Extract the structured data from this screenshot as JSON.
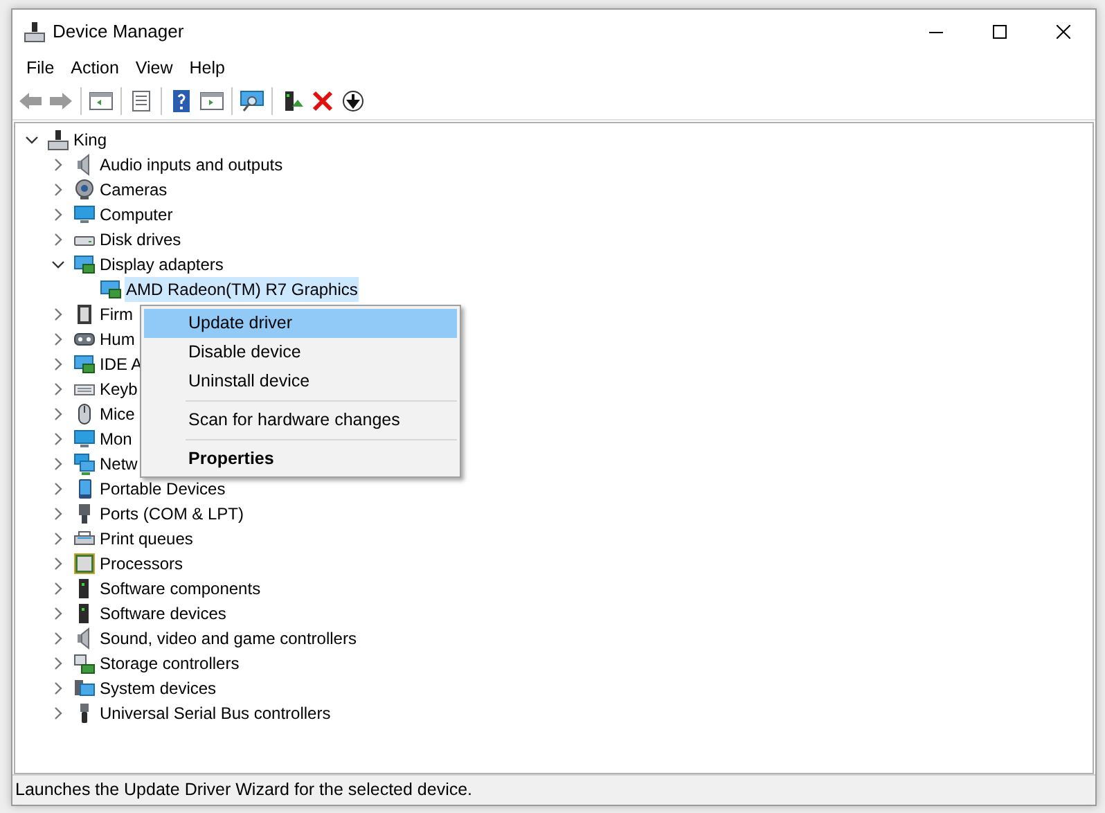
{
  "window": {
    "title": "Device Manager"
  },
  "menu_bar": [
    "File",
    "Action",
    "View",
    "Help"
  ],
  "tree": {
    "label": "King",
    "expanded": true,
    "selected": false,
    "children": [
      {
        "label": "Audio inputs and outputs",
        "expanded": false,
        "selected": false
      },
      {
        "label": "Cameras",
        "expanded": false,
        "selected": false
      },
      {
        "label": "Computer",
        "expanded": false,
        "selected": false
      },
      {
        "label": "Disk drives",
        "expanded": false,
        "selected": false
      },
      {
        "label": "Display adapters",
        "expanded": true,
        "selected": false,
        "children": [
          {
            "label": "AMD Radeon(TM) R7 Graphics",
            "selected": true
          }
        ]
      },
      {
        "label": "Firm",
        "expanded": false,
        "selected": false
      },
      {
        "label": "Hum",
        "expanded": false,
        "selected": false
      },
      {
        "label": "IDE A",
        "expanded": false,
        "selected": false
      },
      {
        "label": "Keyb",
        "expanded": false,
        "selected": false
      },
      {
        "label": "Mice",
        "expanded": false,
        "selected": false
      },
      {
        "label": "Mon",
        "expanded": false,
        "selected": false
      },
      {
        "label": "Netw",
        "expanded": false,
        "selected": false
      },
      {
        "label": "Portable Devices",
        "expanded": false,
        "selected": false
      },
      {
        "label": "Ports (COM & LPT)",
        "expanded": false,
        "selected": false
      },
      {
        "label": "Print queues",
        "expanded": false,
        "selected": false
      },
      {
        "label": "Processors",
        "expanded": false,
        "selected": false
      },
      {
        "label": "Software components",
        "expanded": false,
        "selected": false
      },
      {
        "label": "Software devices",
        "expanded": false,
        "selected": false
      },
      {
        "label": "Sound, video and game controllers",
        "expanded": false,
        "selected": false
      },
      {
        "label": "Storage controllers",
        "expanded": false,
        "selected": false
      },
      {
        "label": "System devices",
        "expanded": false,
        "selected": false
      },
      {
        "label": "Universal Serial Bus controllers",
        "expanded": false,
        "selected": false
      }
    ]
  },
  "context_menu": [
    {
      "label": "Update driver",
      "selected": true,
      "default": false,
      "separator_after": false
    },
    {
      "label": "Disable device",
      "selected": false,
      "default": false,
      "separator_after": false
    },
    {
      "label": "Uninstall device",
      "selected": false,
      "default": false,
      "separator_after": true
    },
    {
      "label": "Scan for hardware changes",
      "selected": false,
      "default": false,
      "separator_after": true
    },
    {
      "label": "Properties",
      "selected": false,
      "default": true,
      "separator_after": false
    }
  ],
  "status_bar": "Launches the Update Driver Wizard for the selected device."
}
